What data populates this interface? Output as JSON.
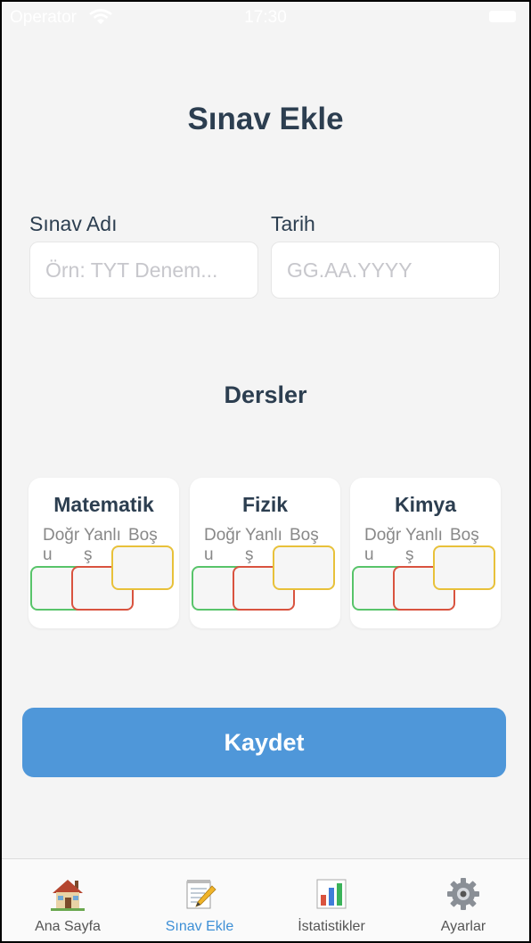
{
  "status_bar": {
    "carrier": "Operator",
    "time": "17:30"
  },
  "page": {
    "title": "Sınav Ekle"
  },
  "form": {
    "exam_name": {
      "label": "Sınav Adı",
      "placeholder": "Örn: TYT Denem...",
      "value": ""
    },
    "date": {
      "label": "Tarih",
      "placeholder": "GG.AA.YYYY",
      "value": ""
    }
  },
  "subjects_section": {
    "title": "Dersler",
    "subjects": [
      {
        "name": "Matematik",
        "labels": {
          "correct": "Doğru",
          "wrong": "Yanlış",
          "empty": "Boş"
        }
      },
      {
        "name": "Fizik",
        "labels": {
          "correct": "Doğru",
          "wrong": "Yanlış",
          "empty": "Boş"
        }
      },
      {
        "name": "Kimya",
        "labels": {
          "correct": "Doğru",
          "wrong": "Yanlış",
          "empty": "Boş"
        }
      }
    ]
  },
  "save_button": {
    "label": "Kaydet"
  },
  "tab_bar": {
    "items": [
      {
        "label": "Ana Sayfa",
        "icon": "house-icon"
      },
      {
        "label": "Sınav Ekle",
        "icon": "memo-pencil-icon",
        "active": true
      },
      {
        "label": "İstatistikler",
        "icon": "bar-chart-icon"
      },
      {
        "label": "Ayarlar",
        "icon": "gear-icon"
      }
    ]
  },
  "colors": {
    "accent": "#4f97d9",
    "title": "#2c3e50",
    "correct_border": "#58c46a",
    "wrong_border": "#d9533f",
    "empty_border": "#e8c13a"
  }
}
